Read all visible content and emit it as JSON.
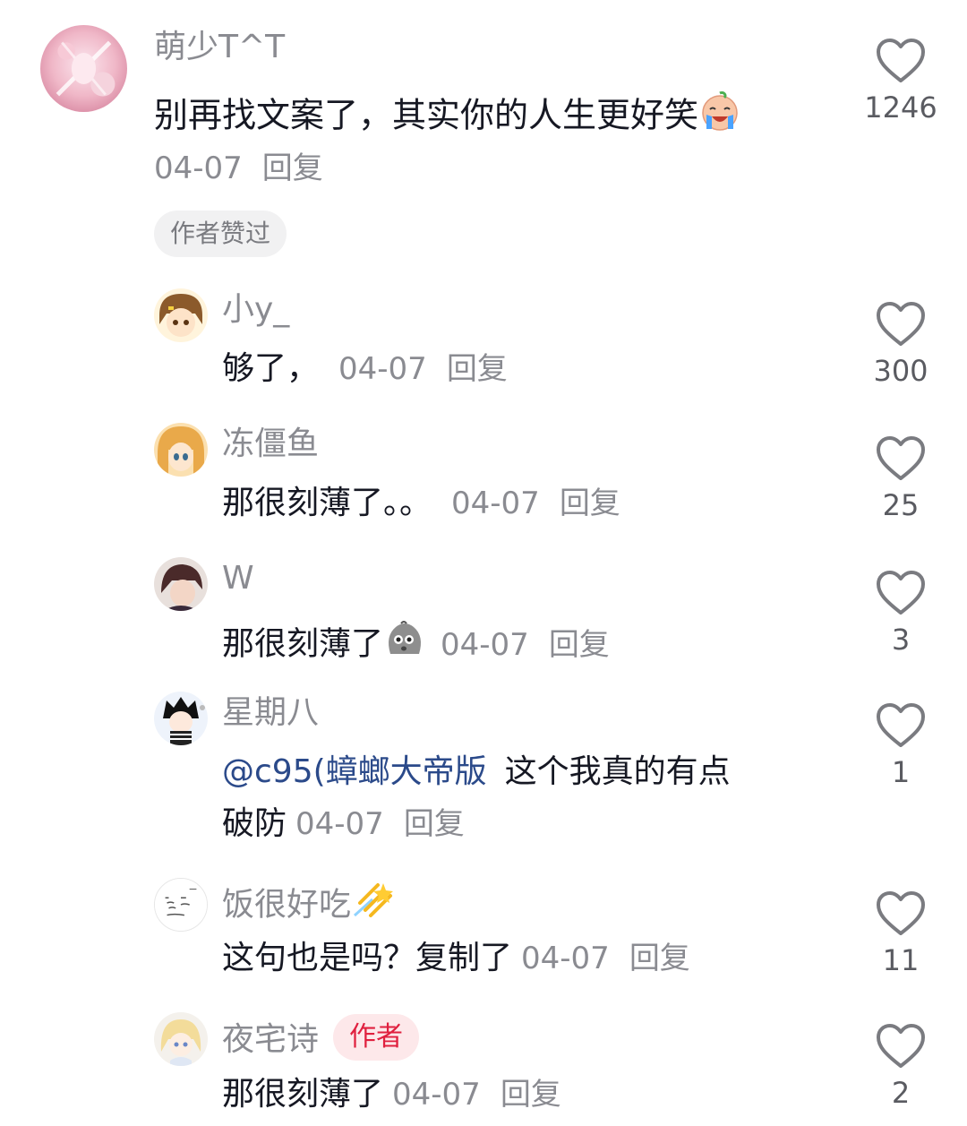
{
  "comments": [
    {
      "username": "萌少T^T",
      "text": "别再找文案了，其实你的人生更好笑",
      "date": "04-07",
      "reply": "回复",
      "likes": "1246",
      "tag": "作者赞过",
      "emoji": "laugh-cry-emoji"
    },
    {
      "username": "小y_",
      "text": "够了，",
      "date": "04-07",
      "reply": "回复",
      "likes": "300"
    },
    {
      "username": "冻僵鱼",
      "text": "那很刻薄了。。",
      "date": "04-07",
      "reply": "回复",
      "likes": "25"
    },
    {
      "username": "W",
      "text": "那很刻薄了",
      "date": "04-07",
      "reply": "回复",
      "likes": "3",
      "emoji": "stone-face-emoji"
    },
    {
      "username": "星期八",
      "mention": "@c95(蟑螂大帝版",
      "text_line1": "这个我真的有点",
      "text_line2": "破防",
      "date": "04-07",
      "reply": "回复",
      "likes": "1"
    },
    {
      "username": "饭很好吃",
      "text": "这句也是吗？复制了",
      "date": "04-07",
      "reply": "回复",
      "likes": "11",
      "name_emoji": "shooting-star-emoji"
    },
    {
      "username": "夜宅诗",
      "badge": "作者",
      "text": "那很刻薄了",
      "date": "04-07",
      "reply": "回复",
      "likes": "2"
    }
  ]
}
